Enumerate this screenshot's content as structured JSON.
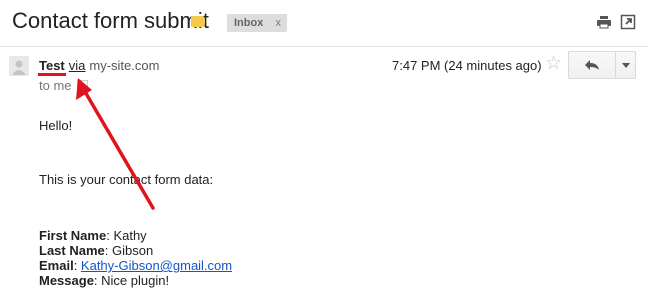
{
  "header": {
    "subject": "Contact form submit",
    "label_chip": "Inbox",
    "label_chip_remove": "x",
    "label_color": "#f2c94c"
  },
  "message": {
    "sender": "Test",
    "via": "via",
    "domain": "my-site.com",
    "to": "to me",
    "timestamp": "7:47 PM (24 minutes ago)"
  },
  "body": {
    "greeting": "Hello!",
    "intro": "This is your contact form data:",
    "fields": [
      {
        "label": "First Name",
        "value": "Kathy"
      },
      {
        "label": "Last Name",
        "value": "Gibson"
      },
      {
        "label": "Email",
        "value": "Kathy-Gibson@gmail.com"
      },
      {
        "label": "Message",
        "value": "Nice plugin!"
      }
    ],
    "separator": ": "
  },
  "icons": {
    "print": "print-icon",
    "popout": "new-window-icon",
    "star": "star-icon",
    "reply": "reply-icon",
    "more": "dropdown-arrow-icon",
    "avatar": "default-avatar-icon"
  },
  "annotation_color": "#e0141c"
}
